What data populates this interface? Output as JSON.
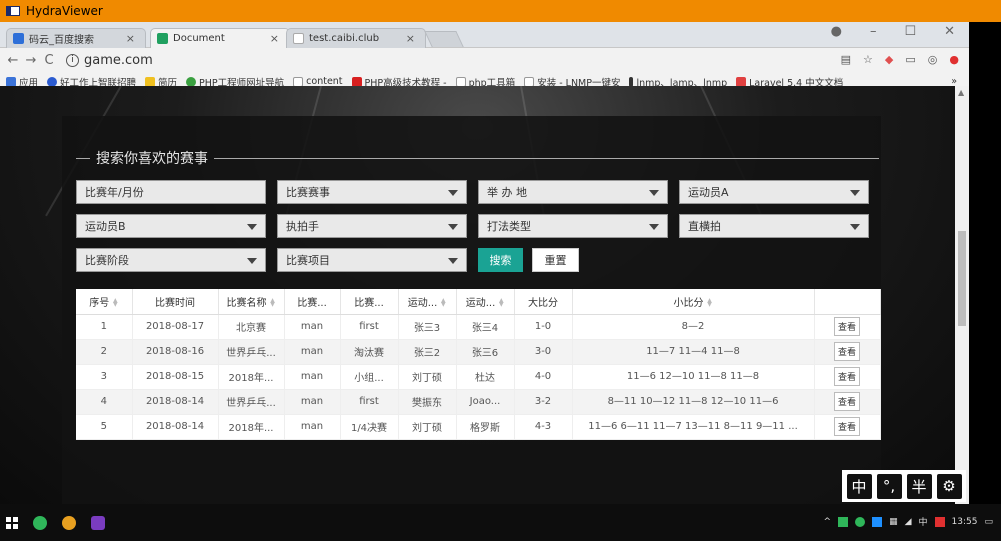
{
  "window": {
    "title": "HydraViewer"
  },
  "browser": {
    "tabs": [
      {
        "label": "码云_百度搜索",
        "color": "#2e6fd8"
      },
      {
        "label": "Document",
        "color": "#20a060"
      },
      {
        "label": "test.caibi.club",
        "color": "#bbbbbb"
      }
    ],
    "url": "game.com",
    "bookmarks": [
      {
        "label": "应用",
        "color": "#3b73d8"
      },
      {
        "label": "好工作上智联招聘",
        "color": "#2b5bd0"
      },
      {
        "label": "简历",
        "color": "#f0c020"
      },
      {
        "label": "PHP工程师网址导航",
        "color": "#3aa040"
      },
      {
        "label": "content",
        "color": "#aaaaaa"
      },
      {
        "label": "PHP高级技术教程 -",
        "color": "#d82020"
      },
      {
        "label": "php工具箱",
        "color": "#aaaaaa"
      },
      {
        "label": "安装 - LNMP一键安",
        "color": "#aaaaaa"
      },
      {
        "label": "lnmp、lamp、lnmp",
        "color": "#333333"
      },
      {
        "label": "Laravel 5.4 中文文档",
        "color": "#e04040"
      }
    ]
  },
  "search": {
    "legend": "搜索你喜欢的赛事",
    "fields": [
      "比赛年/月份",
      "比赛赛事",
      "举 办 地",
      "运动员A",
      "运动员B",
      "执拍手",
      "打法类型",
      "直横拍",
      "比赛阶段",
      "比赛项目"
    ],
    "search_button": "搜索",
    "reset_button": "重置"
  },
  "table": {
    "headers": [
      "序号",
      "比赛时间",
      "比赛名称",
      "比赛...",
      "比赛...",
      "运动...",
      "运动...",
      "大比分",
      "小比分",
      ""
    ],
    "rows": [
      [
        "1",
        "2018-08-17",
        "北京赛",
        "man",
        "first",
        "张三3",
        "张三4",
        "1-0",
        "8—2",
        "查看"
      ],
      [
        "2",
        "2018-08-16",
        "世界乒乓...",
        "man",
        "淘汰赛",
        "张三2",
        "张三6",
        "3-0",
        "11—7  11—4  11—8",
        "查看"
      ],
      [
        "3",
        "2018-08-15",
        "2018年...",
        "man",
        "小组...",
        "刘丁硕",
        "杜达",
        "4-0",
        "11—6  12—10  11—8  11—8",
        "查看"
      ],
      [
        "4",
        "2018-08-14",
        "世界乒乓...",
        "man",
        "first",
        "樊振东",
        "Joao...",
        "3-2",
        "8—11  10—12  11—8  12—10  11—6",
        "查看"
      ],
      [
        "5",
        "2018-08-14",
        "2018年...",
        "man",
        "1/4决赛",
        "刘丁硕",
        "格罗斯",
        "4-3",
        "11—6  6—11  11—7  13—11  8—11  9—11  ...",
        "查看"
      ]
    ]
  },
  "ime": {
    "labels": [
      "中",
      "°,",
      "半",
      "⚙"
    ]
  },
  "tray": {
    "clock": "13:55",
    "lang": "中"
  }
}
